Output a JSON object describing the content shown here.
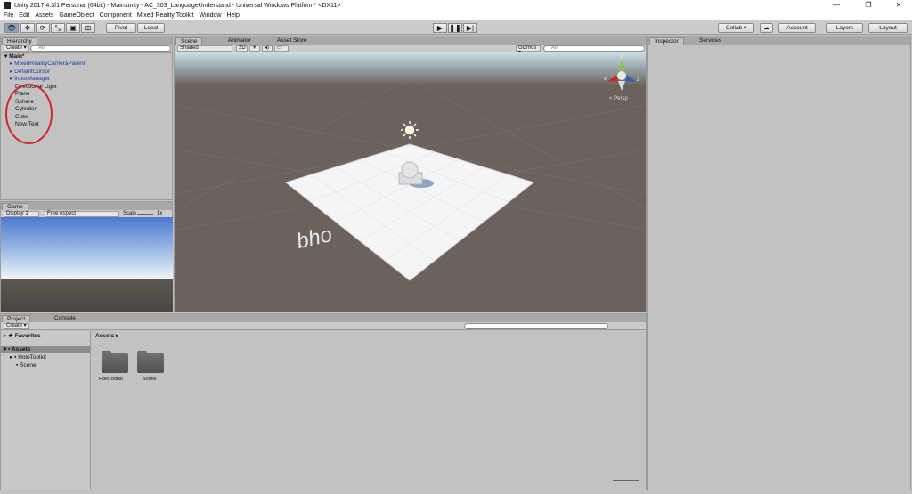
{
  "titlebar": {
    "title": "Unity 2017.4.3f1 Personal (64bit) - Main.unity - AC_303_LanguageUnderstand - Universal Windows Platform* <DX11>",
    "minimize": "—",
    "maximize": "❐",
    "close": "✕"
  },
  "menu": [
    "File",
    "Edit",
    "Assets",
    "GameObject",
    "Component",
    "Mixed Reality Toolkit",
    "Window",
    "Help"
  ],
  "toolbar": {
    "pivot": "Pivot",
    "local": "Local",
    "collab": "Collab ▾",
    "account": "Account",
    "layers": "Layers",
    "layout": "Layout"
  },
  "hierarchy": {
    "tab": "Hierarchy",
    "create": "Create ▾",
    "search_placeholder": "All",
    "scene": "Main*",
    "items": [
      {
        "label": "MixedRealityCameraParent",
        "prefab": true,
        "arrow": true
      },
      {
        "label": "DefaultCursor",
        "prefab": true,
        "arrow": true
      },
      {
        "label": "InputManager",
        "prefab": true,
        "arrow": true
      },
      {
        "label": "Directional Light",
        "prefab": false,
        "arrow": false
      },
      {
        "label": "Plane",
        "prefab": false,
        "arrow": false
      },
      {
        "label": "Sphere",
        "prefab": false,
        "arrow": false
      },
      {
        "label": "Cylinder",
        "prefab": false,
        "arrow": false
      },
      {
        "label": "Cube",
        "prefab": false,
        "arrow": false
      },
      {
        "label": "New Text",
        "prefab": false,
        "arrow": false
      }
    ]
  },
  "scene": {
    "tabs": [
      "Scene",
      "Animator",
      "Asset Store"
    ],
    "shading": "Shaded",
    "mode_2d": "2D",
    "gizmos": "Gizmos ▾",
    "search_placeholder": "All",
    "persp": "< Persp",
    "text_object": "bho",
    "axis_x": "x",
    "axis_z": "z",
    "axis_y": "y"
  },
  "game": {
    "tab": "Game",
    "display": "Display 1",
    "aspect": "Free Aspect",
    "scale_label": "Scale",
    "scale_value": "1x"
  },
  "inspector": {
    "tabs": [
      "Inspector",
      "Services"
    ]
  },
  "project": {
    "tabs": [
      "Project",
      "Console"
    ],
    "create": "Create ▾",
    "favorites": "Favorites",
    "assets": "Assets",
    "tree": [
      "HoloToolkit",
      "Scene"
    ],
    "breadcrumb": "Assets ▸",
    "folders": [
      "HoloToolkit",
      "Scene"
    ]
  },
  "colors": {
    "panel": "#c2c2c2",
    "scene_bg": "#6b625b",
    "sky": "#cfe0e6",
    "annotation": "#d0262b"
  }
}
